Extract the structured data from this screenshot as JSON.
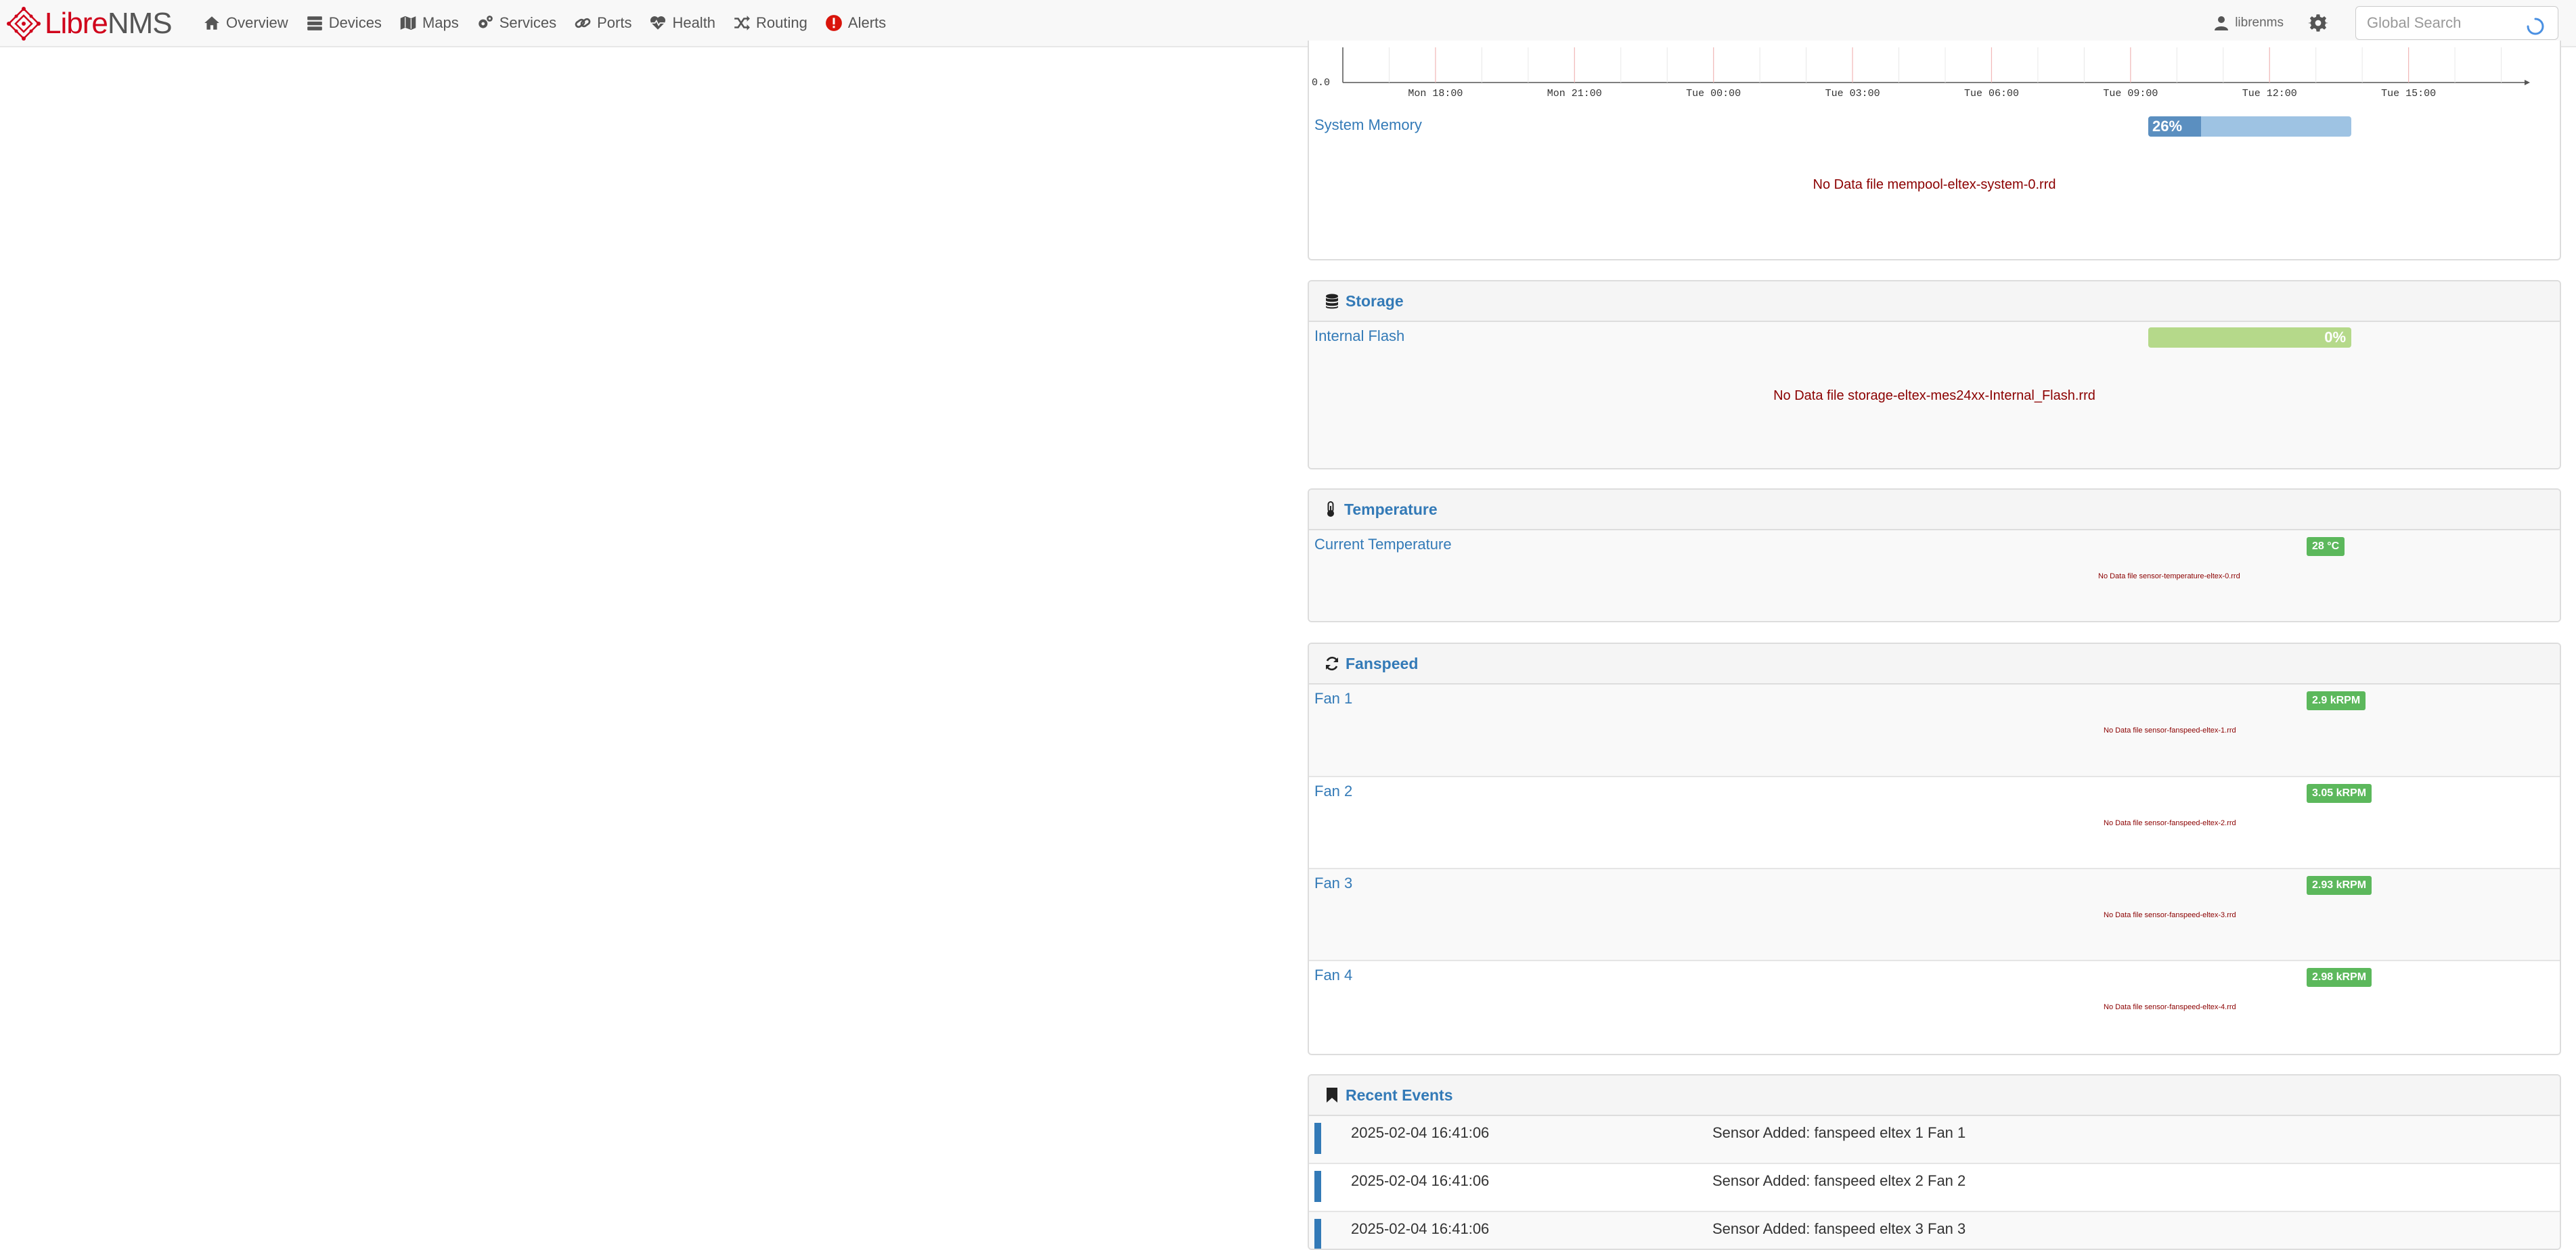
{
  "brand": {
    "part1": "Libre",
    "part2": "NMS"
  },
  "nav": {
    "items": [
      {
        "label": "Overview",
        "icon": "home-icon"
      },
      {
        "label": "Devices",
        "icon": "server-icon"
      },
      {
        "label": "Maps",
        "icon": "map-icon"
      },
      {
        "label": "Services",
        "icon": "cogs-icon"
      },
      {
        "label": "Ports",
        "icon": "link-icon"
      },
      {
        "label": "Health",
        "icon": "heartbeat-icon"
      },
      {
        "label": "Routing",
        "icon": "random-icon"
      },
      {
        "label": "Alerts",
        "icon": "alert-icon"
      }
    ],
    "user": "librenms",
    "search_placeholder": "Global Search"
  },
  "graph": {
    "y_tick": "0.0",
    "x_ticks": [
      "Mon 18:00",
      "Mon 21:00",
      "Tue 00:00",
      "Tue 03:00",
      "Tue 06:00",
      "Tue 09:00",
      "Tue 12:00",
      "Tue 15:00"
    ]
  },
  "memory": {
    "label": "System Memory",
    "percent": 26,
    "percent_text": "26%",
    "nodata": "No Data file mempool-eltex-system-0.rrd"
  },
  "storage": {
    "title": "Storage",
    "label": "Internal Flash",
    "percent": 0,
    "percent_text": "0%",
    "nodata": "No Data file storage-eltex-mes24xx-Internal_Flash.rrd"
  },
  "temperature": {
    "title": "Temperature",
    "label": "Current Temperature",
    "value": "28 °C",
    "nodata": "No Data file sensor-temperature-eltex-0.rrd"
  },
  "fanspeed": {
    "title": "Fanspeed",
    "fans": [
      {
        "label": "Fan 1",
        "value": "2.9 kRPM",
        "nodata": "No Data file sensor-fanspeed-eltex-1.rrd"
      },
      {
        "label": "Fan 2",
        "value": "3.05 kRPM",
        "nodata": "No Data file sensor-fanspeed-eltex-2.rrd"
      },
      {
        "label": "Fan 3",
        "value": "2.93 kRPM",
        "nodata": "No Data file sensor-fanspeed-eltex-3.rrd"
      },
      {
        "label": "Fan 4",
        "value": "2.98 kRPM",
        "nodata": "No Data file sensor-fanspeed-eltex-4.rrd"
      }
    ]
  },
  "events": {
    "title": "Recent Events",
    "items": [
      {
        "time": "2025-02-04 16:41:06",
        "message": "Sensor Added: fanspeed eltex 1 Fan 1"
      },
      {
        "time": "2025-02-04 16:41:06",
        "message": "Sensor Added: fanspeed eltex 2 Fan 2"
      },
      {
        "time": "2025-02-04 16:41:06",
        "message": "Sensor Added: fanspeed eltex 3 Fan 3"
      }
    ]
  },
  "colors": {
    "link": "#337ab7",
    "nodata": "#8b0000",
    "badge_green": "#5cb85c",
    "memory_bar_used": "#5b8fc0",
    "memory_bar_free": "#9ec3e3",
    "storage_bar": "#b5d98a",
    "brand_red": "#d0021b"
  }
}
